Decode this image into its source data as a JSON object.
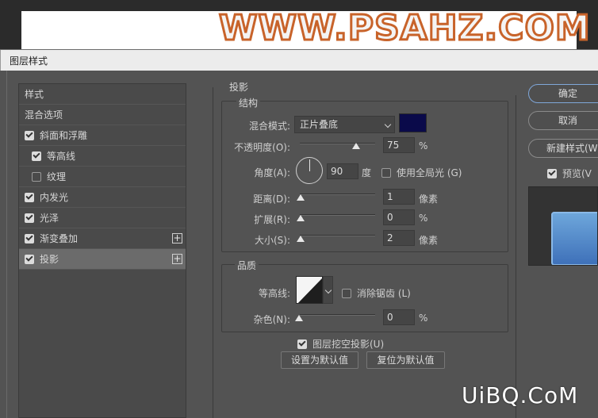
{
  "canvas": {
    "watermark": "WWW.PSAHZ.COM"
  },
  "dialog": {
    "title": "图层样式"
  },
  "sidebar": {
    "items": [
      {
        "label": "样式",
        "checkbox": false
      },
      {
        "label": "混合选项",
        "checkbox": false
      },
      {
        "label": "斜面和浮雕",
        "checkbox": true,
        "checked": true
      },
      {
        "label": "等高线",
        "checkbox": true,
        "checked": true
      },
      {
        "label": "纹理",
        "checkbox": true,
        "checked": false
      },
      {
        "label": "内发光",
        "checkbox": true,
        "checked": true
      },
      {
        "label": "光泽",
        "checkbox": true,
        "checked": true
      },
      {
        "label": "渐变叠加",
        "checkbox": true,
        "checked": true,
        "plus": "+"
      },
      {
        "label": "投影",
        "checkbox": true,
        "checked": true,
        "plus": "+",
        "active": true
      }
    ]
  },
  "panel": {
    "title": "投影",
    "structure": {
      "title": "结构",
      "blend_mode_label": "混合模式:",
      "blend_mode_value": "正片叠底",
      "shadow_color": "#0a0a4a",
      "opacity_label": "不透明度(O):",
      "opacity_value": "75",
      "opacity_unit": "%",
      "angle_label": "角度(A):",
      "angle_value": "90",
      "angle_unit": "度",
      "global_light_label": "使用全局光 (G)",
      "global_light_checked": false,
      "distance_label": "距离(D):",
      "distance_value": "1",
      "distance_unit": "像素",
      "spread_label": "扩展(R):",
      "spread_value": "0",
      "spread_unit": "%",
      "size_label": "大小(S):",
      "size_value": "2",
      "size_unit": "像素"
    },
    "quality": {
      "title": "品质",
      "contour_label": "等高线:",
      "antialias_label": "消除锯齿 (L)",
      "antialias_checked": false,
      "noise_label": "杂色(N):",
      "noise_value": "0",
      "noise_unit": "%"
    },
    "knockout_label": "图层挖空投影(U)",
    "knockout_checked": true,
    "set_default_label": "设置为默认值",
    "reset_default_label": "复位为默认值"
  },
  "right": {
    "ok_label": "确定",
    "cancel_label": "取消",
    "new_style_label": "新建样式(W",
    "preview_label": "预览(V",
    "preview_checked": true
  },
  "footer": {
    "watermark": "UiBQ.CoM"
  }
}
